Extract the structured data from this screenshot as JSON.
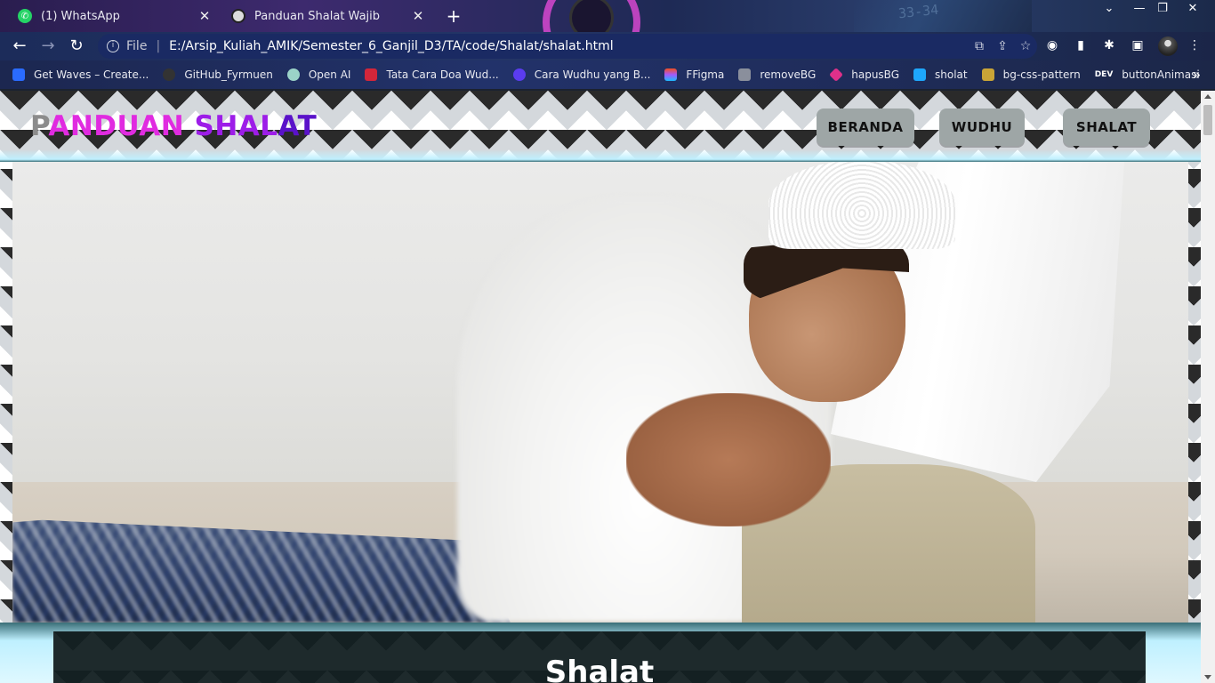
{
  "browser": {
    "tabs": [
      {
        "title": "(1) WhatsApp",
        "icon": "whatsapp-icon"
      },
      {
        "title": "Panduan Shalat Wajib",
        "icon": "globe-icon"
      }
    ],
    "address": {
      "scheme": "File",
      "url": "E:/Arsip_Kuliah_AMIK/Semester_6_Ganjil_D3/TA/code/Shalat/shalat.html"
    },
    "bookmarks": [
      {
        "label": "Get Waves – Create...",
        "color": "#2a6bff"
      },
      {
        "label": "GitHub_Fyrmuen",
        "color": "#333333"
      },
      {
        "label": "Open AI",
        "color": "#9bd3c8"
      },
      {
        "label": "Tata Cara Doa Wud...",
        "color": "#d3263a"
      },
      {
        "label": "Cara Wudhu yang B...",
        "color": "#5b3cf0"
      },
      {
        "label": "FFigma",
        "color": "#f24e1e"
      },
      {
        "label": "removeBG",
        "color": "#8a8f9c"
      },
      {
        "label": "hapusBG",
        "color": "#e0308a"
      },
      {
        "label": "sholat",
        "color": "#1ea7fd"
      },
      {
        "label": "bg-css-pattern",
        "color": "#c9a437"
      },
      {
        "label": "buttonAnimasi",
        "color": "#1c1c1c",
        "prefix": "DEV"
      }
    ]
  },
  "page": {
    "logo": {
      "part1": "P",
      "part2": "ANDUAN ",
      "part3": "SHAL",
      "part4": "AT"
    },
    "nav": [
      "BERANDA",
      "WUDHU",
      "SHALAT"
    ],
    "section_title": "Shalat",
    "colors": {
      "nav_button": "#9ea6a6",
      "accent_glow": "#bff0ff",
      "logo_pink": "#e02be0",
      "logo_purple": "#5a12c9"
    }
  }
}
